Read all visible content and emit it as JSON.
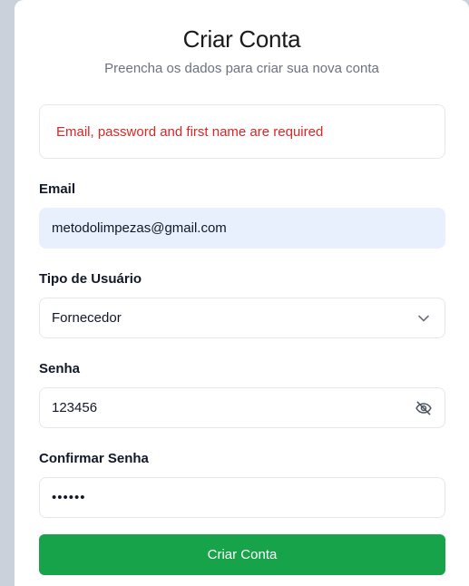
{
  "header": {
    "title": "Criar Conta",
    "subtitle": "Preencha os dados para criar sua nova conta"
  },
  "error": {
    "message": "Email, password and first name are required"
  },
  "form": {
    "email": {
      "label": "Email",
      "value": "metodolimpezas@gmail.com"
    },
    "user_type": {
      "label": "Tipo de Usuário",
      "selected": "Fornecedor",
      "icon": "chevron-down-icon"
    },
    "password": {
      "label": "Senha",
      "value": "123456",
      "icon": "eye-off-icon"
    },
    "confirm_password": {
      "label": "Confirmar Senha",
      "masked_value": "••••••"
    },
    "submit_label": "Criar Conta"
  },
  "colors": {
    "accent": "#16a34a",
    "error": "#dc2626",
    "autofill_bg": "#e8f0fe"
  }
}
